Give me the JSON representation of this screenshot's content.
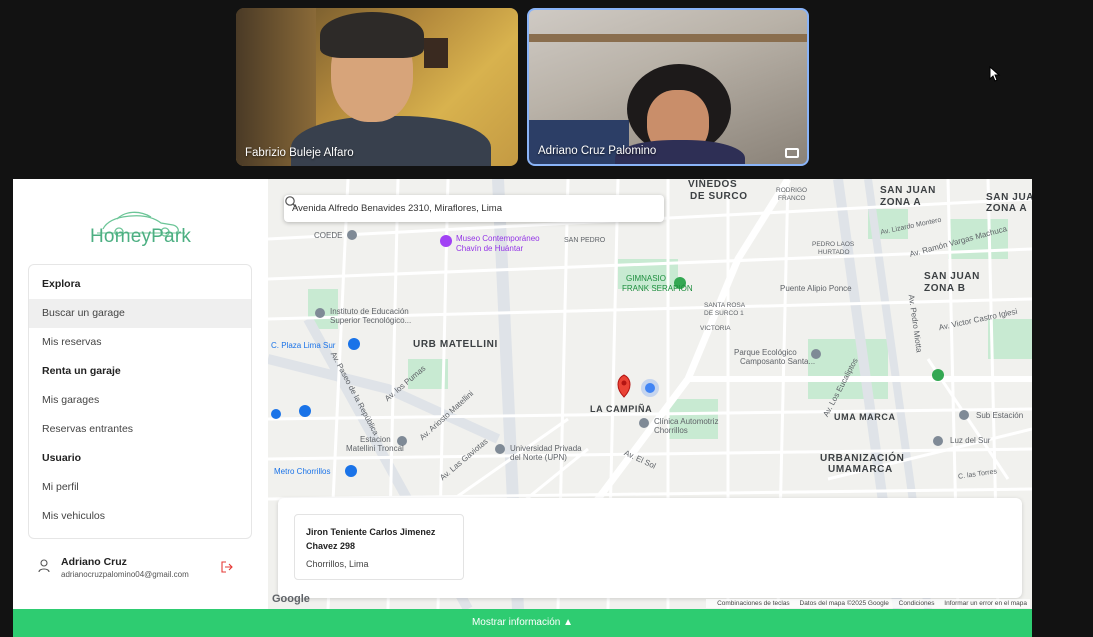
{
  "meeting": {
    "participants": [
      {
        "name": "Fabrizio Buleje Alfaro"
      },
      {
        "name": "Adriano Cruz Palomino"
      }
    ]
  },
  "brand": {
    "name": "HomeyPark",
    "accent": "#2ecc71"
  },
  "sidebar": {
    "items": [
      {
        "label": "Explora",
        "type": "section"
      },
      {
        "label": "Buscar un garage",
        "type": "item",
        "active": true
      },
      {
        "label": "Mis reservas",
        "type": "item"
      },
      {
        "label": "Renta un garaje",
        "type": "section"
      },
      {
        "label": "Mis garages",
        "type": "item"
      },
      {
        "label": "Reservas entrantes",
        "type": "item"
      },
      {
        "label": "Usuario",
        "type": "section"
      },
      {
        "label": "Mi perfil",
        "type": "item"
      },
      {
        "label": "Mis vehiculos",
        "type": "item"
      }
    ]
  },
  "user": {
    "name": "Adriano Cruz",
    "email": "adrianocruzpalomino04@gmail.com"
  },
  "search": {
    "value": "Avenida Alfredo Benavides 2310, Miraflores, Lima"
  },
  "map": {
    "labels": {
      "vinedos": "VIÑEDOS",
      "de_surco": "DE SURCO",
      "san_juan_a": "SAN JUAN",
      "zona_a": "ZONA A",
      "san_juan_a2": "SAN JUAN",
      "zona_a2": "ZONA A",
      "san_juan_b": "SAN JUAN",
      "zona_b": "ZONA B",
      "urb_matellini": "URB MATELLINI",
      "la_campina": "LA CAMPIÑA",
      "uma_marca": "UMA MARCA",
      "urbanizacion": "URBANIZACIÓN",
      "umamarca": "UMAMARCA",
      "coede": "COEDE",
      "museo": "Museo Contemporáneo",
      "museo2": "Chavín de Huántar",
      "san_pedro": "SAN PEDRO",
      "gimnasio": "GIMNASIO",
      "gimnasio2": "FRANK SERAPIÓN",
      "santa_rosa": "SANTA ROSA",
      "santa_rosa2": "DE SURCO 1",
      "victoria": "VICTORIA",
      "instituto": "Instituto de Educación",
      "instituto2": "Superior Tecnológico...",
      "plaza_lima_sur": "C. Plaza Lima Sur",
      "puente": "Puente Alipio Ponce",
      "parque": "Parque Ecológico",
      "parque2": "Camposanto Santa...",
      "clinica": "Clínica Automotriz",
      "clinica2": "Chorrillos",
      "upn": "Universidad Privada",
      "upn2": "del Norte (UPN)",
      "estacion": "Estacion",
      "estacion2": "Matellini Troncal",
      "metro": "Metro Chorrillos",
      "luz": "Luz del Sur",
      "sub_estacion": "Sub Estación",
      "av_el_sol": "Av. El Sol",
      "av_los_eucaliptos": "Av. Los Eucaliptos",
      "av_pedro_miotta": "Av. Pedro Miotta",
      "av_victor": "Av. Victor Castro Iglesi",
      "av_ramon": "Av. Ramón Vargas Machuca",
      "av_lizardo": "Av. Lizardo Montero",
      "av_paseo": "Av. Paseo de la República",
      "av_pumas": "Av. los Pumas",
      "av_ariosto": "Av. Ariosto Matellini",
      "av_gaviotas": "Av. Las Gaviotas",
      "calle_torres": "C. las Torres",
      "pedro_lagos": "PEDRO LAOS",
      "hurtado": "HURTADO",
      "rodrigo": "RODRIGO",
      "franco": "FRANCO"
    },
    "google": "Google",
    "attribution": [
      "Combinaciones de teclas",
      "Datos del mapa ©2025 Google",
      "Condiciones",
      "Informar un error en el mapa"
    ],
    "colors": {
      "road": "#ffffff",
      "major_road": "#dfe3e8",
      "park": "#c8ead2",
      "pin": "#ea4335",
      "location": "#4285f4"
    }
  },
  "result": {
    "address": "Jiron Teniente Carlos Jimenez Chavez 298",
    "city": "Chorrillos, Lima"
  },
  "footer": {
    "label": "Mostrar información ▲"
  }
}
